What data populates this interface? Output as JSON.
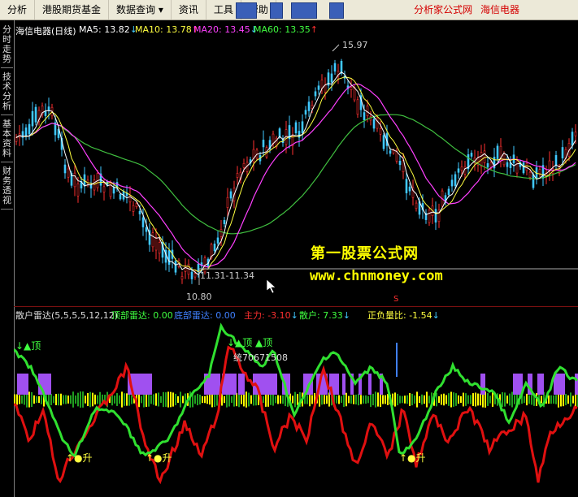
{
  "menubar": {
    "items": [
      "分析",
      "港股期货基金",
      "数据查询",
      "资讯",
      "工具",
      "帮助"
    ],
    "right_links": [
      "分析家公式网",
      "海信电器"
    ]
  },
  "side_tabs": [
    {
      "label": "分时走势"
    },
    {
      "label": "技术分析"
    },
    {
      "label": "基本资料"
    },
    {
      "label": "财务透视"
    }
  ],
  "main_chart": {
    "stock_name": "海信电器(日线)",
    "indicators": [
      {
        "label": "MA5: 13.82",
        "arrow": "↓",
        "color": "#ffffff"
      },
      {
        "label": "MA10: 13.78",
        "arrow": "↑",
        "color": "#ffff40"
      },
      {
        "label": "MA20: 13.45",
        "arrow": "↓",
        "color": "#ff40ff"
      },
      {
        "label": "MA60: 13.35",
        "arrow": "↑",
        "color": "#40ff40"
      }
    ],
    "high_label": "15.97",
    "low_label": "10.80",
    "range_label": "11.31-11.34",
    "colors": {
      "up": "#ff3030",
      "down": "#40c8ff",
      "ma5": "#ffffff",
      "ma10": "#ffff40",
      "ma20": "#ff40ff",
      "ma60": "#40c040"
    }
  },
  "watermark": {
    "line1": "第一股票公式网",
    "line2": "www.chnmoney.com"
  },
  "indicator_panel": {
    "name": "散户雷达(5,5,5,5,12,12)",
    "values": [
      {
        "label": "顶部雷达: 0.00",
        "color": "#40ff40"
      },
      {
        "label": "底部雷达: 0.00",
        "color": "#4080ff"
      },
      {
        "label": "主力: -3.10",
        "arrow": "↓",
        "color": "#ff3030"
      },
      {
        "label": "散户: 7.33",
        "arrow": "↓",
        "color": "#40ff40"
      },
      {
        "label": "正负量比: -1.54",
        "arrow": "↓",
        "color": "#ffff40"
      }
    ],
    "top_signals": [
      "↓▲顶",
      "↓▲顶",
      "▲顶"
    ],
    "bottom_signals": [
      "↑●升",
      "↑●升",
      "↑●升"
    ],
    "number_label": "统70671508",
    "colors": {
      "green_line": "#30e030",
      "red_line": "#e01010",
      "purple_block": "#a050f0",
      "yellow_bar": "#ffff00",
      "green_bar": "#20a020",
      "blue_spike": "#4080ff"
    }
  }
}
